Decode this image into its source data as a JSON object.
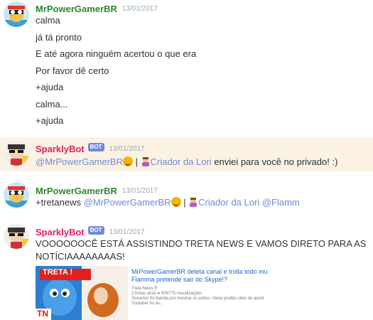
{
  "messages": {
    "m1": {
      "author": "MrPowerGamerBR",
      "timestamp": "13/01/2017",
      "lines": [
        "calma",
        "já tá pronto",
        "E até agora ninguém acertou o que era",
        "Por favor dê certo",
        "+ajuda",
        "calma...",
        "+ajuda"
      ]
    },
    "m2": {
      "author": "SparklyBot",
      "bot_tag": "BOT",
      "timestamp": "13/01/2017",
      "mention_user": "@MrPowerGamerBR",
      "separator": "|",
      "mention_role": "Criador da Lori",
      "text_after": " enviei para você no privado! :)"
    },
    "m3": {
      "author": "MrPowerGamerBR",
      "timestamp": "13/01/2017",
      "text_before": "+tretanews ",
      "mention_user": "@MrPowerGamerBR",
      "separator": "|",
      "mention_role": "Criador da Lori",
      "mention_extra": "@Flamm"
    },
    "m4": {
      "author": "SparklyBot",
      "bot_tag": "BOT",
      "timestamp": "13/01/2017",
      "line1": "VOOOOOOCÊ ESTÁ ASSISTINDO TRETA NEWS E VAMOS DIRETO PARA AS",
      "line2": "NOTÍCIAAAAAAAAS!",
      "embed": {
        "thumb_label": "TRETA !",
        "thumb_logo": "TN",
        "title_line1": "MrPowerGamerBR deleta canal e trolla todo mu",
        "title_line2": "Flamma pretende sair do Skype!?",
        "channel": "Treta News ®",
        "meta": "2 horas atrás ● 608775 visualizações",
        "desc_line1": "Streamer foi banida por mostrar os peitos, Valve proibiu sites de apost",
        "desc_line2": "Youtuber foi as..."
      }
    }
  },
  "colors": {
    "user_green": "#2b8a2b",
    "bot_pink": "#e91e63",
    "mention_blue": "#7289da",
    "highlight_bg": "#fbf2e3"
  }
}
